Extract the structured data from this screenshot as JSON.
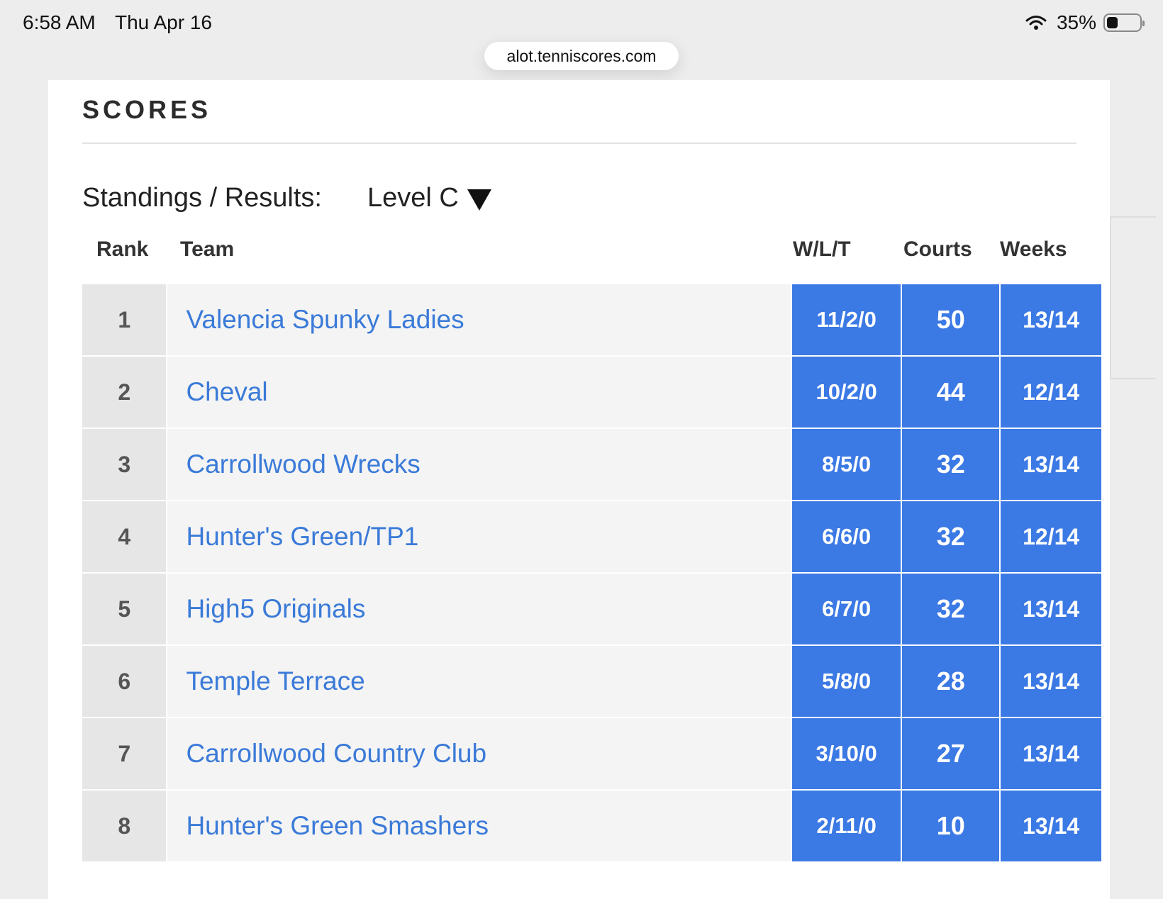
{
  "status_bar": {
    "time": "6:58 AM",
    "date": "Thu Apr 16",
    "battery": "35%",
    "battery_level": 0.35
  },
  "browser": {
    "url": "alot.tenniscores.com"
  },
  "page": {
    "title": "SCORES",
    "standings_label": "Standings / Results:",
    "level_selected": "Level C",
    "columns": {
      "rank": "Rank",
      "team": "Team",
      "wlt": "W/L/T",
      "courts": "Courts",
      "weeks": "Weeks"
    },
    "rows": [
      {
        "rank": "1",
        "team": "Valencia Spunky Ladies",
        "wlt": "11/2/0",
        "courts": "50",
        "weeks": "13/14"
      },
      {
        "rank": "2",
        "team": "Cheval",
        "wlt": "10/2/0",
        "courts": "44",
        "weeks": "12/14"
      },
      {
        "rank": "3",
        "team": "Carrollwood Wrecks",
        "wlt": "8/5/0",
        "courts": "32",
        "weeks": "13/14"
      },
      {
        "rank": "4",
        "team": "Hunter's Green/TP1",
        "wlt": "6/6/0",
        "courts": "32",
        "weeks": "12/14"
      },
      {
        "rank": "5",
        "team": "High5 Originals",
        "wlt": "6/7/0",
        "courts": "32",
        "weeks": "13/14"
      },
      {
        "rank": "6",
        "team": "Temple Terrace",
        "wlt": "5/8/0",
        "courts": "28",
        "weeks": "13/14"
      },
      {
        "rank": "7",
        "team": "Carrollwood Country Club",
        "wlt": "3/10/0",
        "courts": "27",
        "weeks": "13/14"
      },
      {
        "rank": "8",
        "team": "Hunter's Green Smashers",
        "wlt": "2/11/0",
        "courts": "10",
        "weeks": "13/14"
      }
    ]
  },
  "colors": {
    "accent_blue": "#3b79e5",
    "link_blue": "#3a7ad8"
  }
}
